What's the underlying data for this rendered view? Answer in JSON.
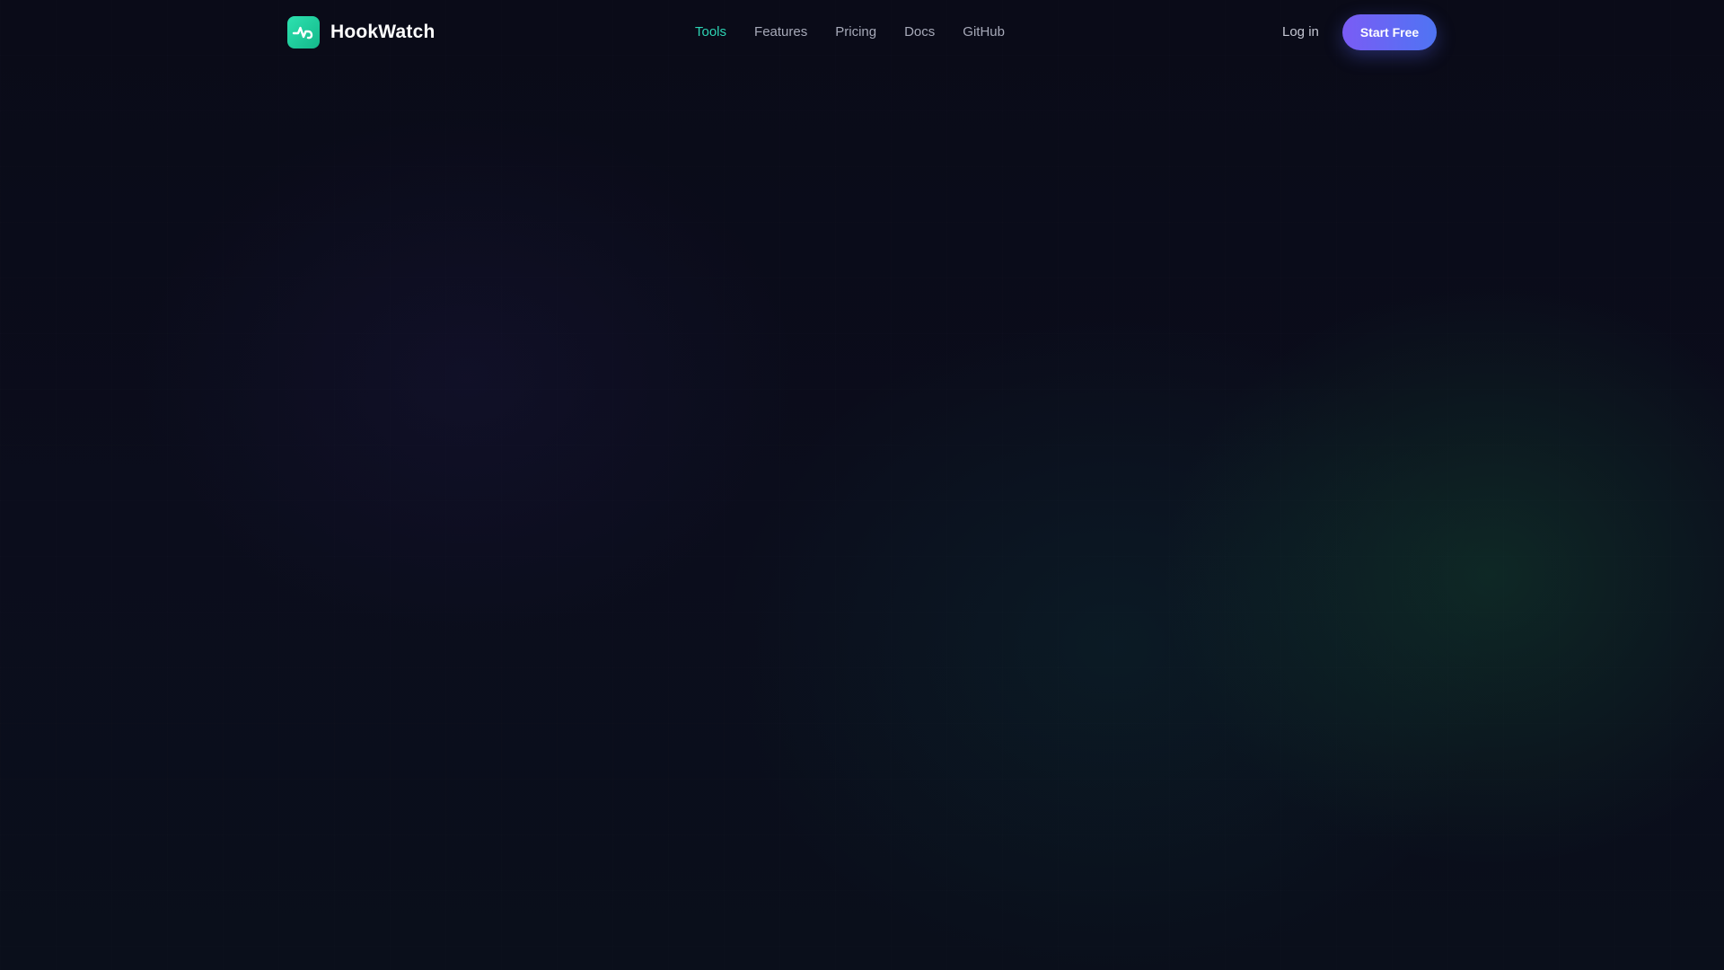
{
  "brand": {
    "name": "HookWatch",
    "logo_icon": "pulse-hook-icon",
    "logo_color": "#2de2b0"
  },
  "nav": {
    "items": [
      {
        "label": "Tools",
        "active": true
      },
      {
        "label": "Features",
        "active": false
      },
      {
        "label": "Pricing",
        "active": false
      },
      {
        "label": "Docs",
        "active": false
      },
      {
        "label": "GitHub",
        "active": false
      }
    ],
    "active_color": "#2dd4b4"
  },
  "auth": {
    "login_label": "Log in",
    "cta_label": "Start Free",
    "cta_gradient": [
      "#7a5cf5",
      "#4f74f3"
    ]
  },
  "theme": {
    "background": "#0a0c18",
    "glow_green": "#145a37",
    "glow_teal": "#0c3c3c"
  }
}
